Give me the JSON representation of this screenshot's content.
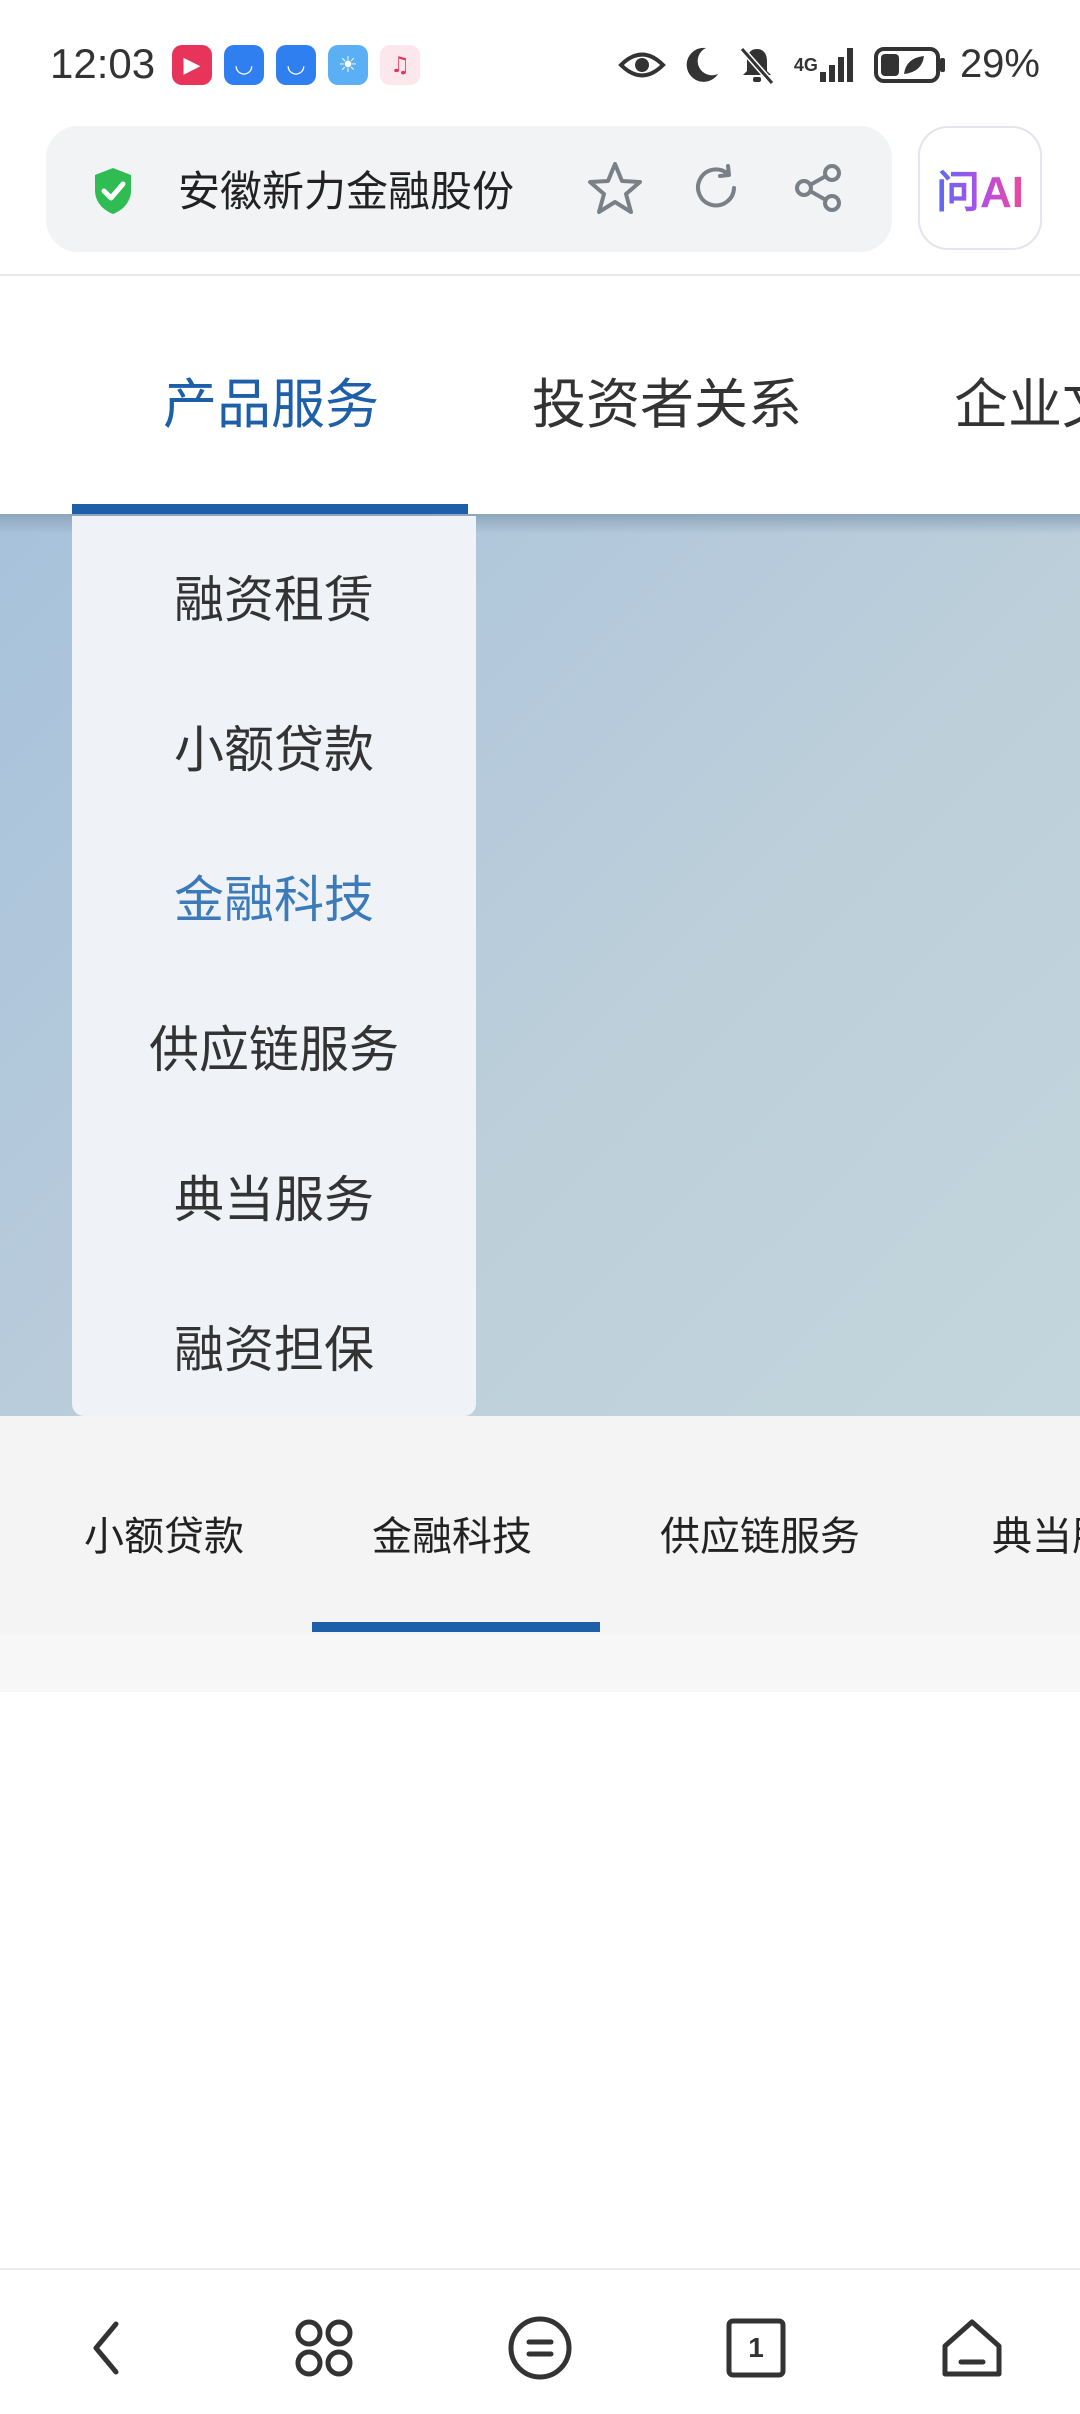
{
  "status_bar": {
    "time": "12:03",
    "network": "4G",
    "battery": "29%",
    "apps": [
      {
        "name": "video-app-icon",
        "color": "#e8345a",
        "glyph": "▶"
      },
      {
        "name": "honor-store-icon",
        "color": "#2f7ff0",
        "glyph": "◡"
      },
      {
        "name": "honor-store-icon-2",
        "color": "#2f7ff0",
        "glyph": "◡"
      },
      {
        "name": "weather-icon",
        "color": "#54aaf2",
        "glyph": "☀"
      },
      {
        "name": "music-icon",
        "color": "#fbe4ea",
        "glyph": "♫"
      }
    ]
  },
  "browser": {
    "page_title": "安徽新力金融股份",
    "ai_label": "问AI"
  },
  "site_nav": {
    "items": [
      "产品服务",
      "投资者关系",
      "企业文"
    ],
    "active_color": "#1d5fa8"
  },
  "dropdown": {
    "items": [
      "融资租赁",
      "小额贷款",
      "金融科技",
      "供应链服务",
      "典当服务",
      "融资担保"
    ],
    "active_index": 2
  },
  "sub_tabs": {
    "items": [
      "小额贷款",
      "金融科技",
      "供应链服务",
      "典当服"
    ],
    "active_index": 1
  },
  "bottom_nav": {
    "icons": [
      "back-icon",
      "apps-icon",
      "menu-icon",
      "tabs-icon",
      "home-icon"
    ],
    "tab_count": "1"
  }
}
